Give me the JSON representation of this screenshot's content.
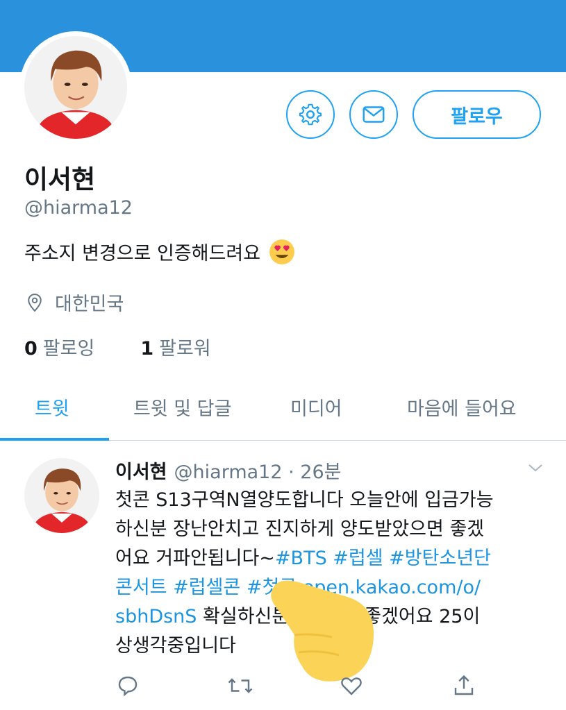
{
  "profile": {
    "name": "이서현",
    "handle": "@hiarma12",
    "bio": "주소지 변경으로 인증해드려요",
    "location": "대한민국",
    "following_count": "0",
    "following_label": "팔로잉",
    "followers_count": "1",
    "followers_label": "팔로워"
  },
  "header": {
    "follow_label": "팔로우"
  },
  "tabs": [
    {
      "label": "트윗",
      "active": true
    },
    {
      "label": "트윗 및 답글",
      "active": false
    },
    {
      "label": "미디어",
      "active": false
    },
    {
      "label": "마음에 들어요",
      "active": false
    }
  ],
  "tweet": {
    "name": "이서현",
    "handle": "@hiarma12 · 26분",
    "line1": "첫콘 S13구역N열양도합니다 오늘안에 입금가능",
    "line2": "하신분 장난안치고 진지하게 양도받았으면 좋겠",
    "line3_text": "어요 거파안됩니다~",
    "line3_link": "#BTS #럽셀 #방탄소년단",
    "line4_link": "콘서트 #럽셀콘 #첫콘 open.kakao.com/o/",
    "line5_link": "sbhDsnS",
    "line5_text": " 확실하신분이였으면 좋겠어요 25이",
    "line6": "상생각중입니다"
  },
  "icons": {
    "settings": "gear-icon",
    "message": "envelope-icon",
    "location": "map-pin-icon",
    "reply": "reply-icon",
    "retweet": "retweet-icon",
    "like": "heart-icon",
    "share": "share-icon",
    "chevron": "chevron-down-icon",
    "bio_emoji": "heart-eyes-emoji"
  },
  "colors": {
    "banner": "#2a91dd",
    "accent": "#1da1f2",
    "link": "#1b95e0",
    "secondary_text": "#657786"
  }
}
